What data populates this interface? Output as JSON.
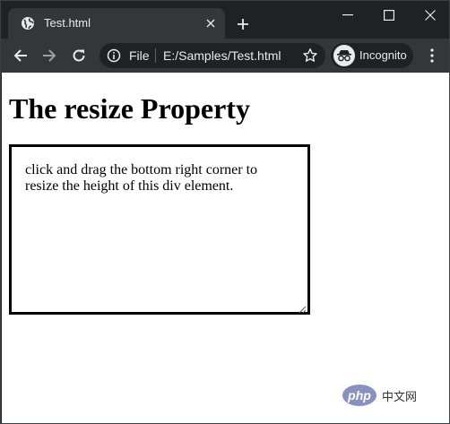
{
  "tab": {
    "title": "Test.html"
  },
  "omnibox": {
    "scheme": "File",
    "url": "E:/Samples/Test.html"
  },
  "profile": {
    "label": "Incognito"
  },
  "page": {
    "title": "The resize Property",
    "resizable_text": "click and drag the bottom right corner to resize the height of this div element."
  },
  "watermark": {
    "logo": "php",
    "text": "中文网"
  },
  "icons": {
    "favicon": "globe-icon",
    "tab_close": "close-icon",
    "new_tab": "plus-icon",
    "minimize": "minimize-icon",
    "maximize": "maximize-icon",
    "close_window": "close-icon",
    "back": "arrow-left-icon",
    "forward": "arrow-right-icon",
    "reload": "reload-icon",
    "info": "info-icon",
    "bookmark": "star-icon",
    "incognito": "incognito-icon",
    "menu": "kebab-menu-icon"
  },
  "colors": {
    "frame": "#202124",
    "toolbar": "#35363a",
    "text_light": "#e8eaed",
    "forward_disabled": "#9aa0a6"
  }
}
